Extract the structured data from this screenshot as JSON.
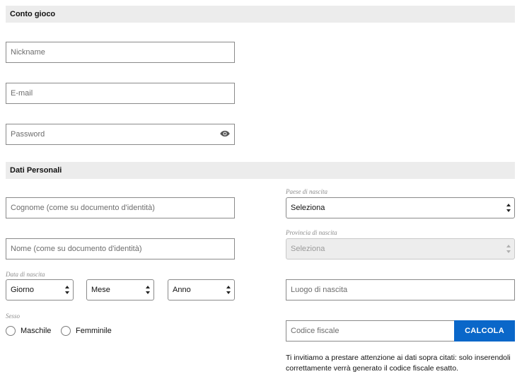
{
  "sections": {
    "account_title": "Conto gioco",
    "personal_title": "Dati Personali"
  },
  "account": {
    "nickname_placeholder": "Nickname",
    "email_placeholder": "E-mail",
    "password_placeholder": "Password",
    "password_toggle_icon": "eye-icon"
  },
  "personal": {
    "surname_placeholder": "Cognome (come su documento d'identità)",
    "name_placeholder": "Nome (come su documento d'identità)",
    "birth_date_label": "Data di nascita",
    "day_value": "Giorno",
    "month_value": "Mese",
    "year_value": "Anno",
    "sex_label": "Sesso",
    "male_label": "Maschile",
    "female_label": "Femminile",
    "birth_country_label": "Paese di nascita",
    "birth_country_value": "Seleziona",
    "birth_province_label": "Provincia di nascita",
    "birth_province_value": "Seleziona",
    "birth_place_placeholder": "Luogo di nascita",
    "tax_code_placeholder": "Codice fiscale",
    "calculate_label": "CALCOLA",
    "notice_text": "Ti invitiamo a prestare attenzione ai dati sopra citati: solo inserendoli correttamente verrà generato il codice fiscale esatto."
  },
  "colors": {
    "accent": "#0a67c9",
    "section_bg": "#ececec"
  }
}
